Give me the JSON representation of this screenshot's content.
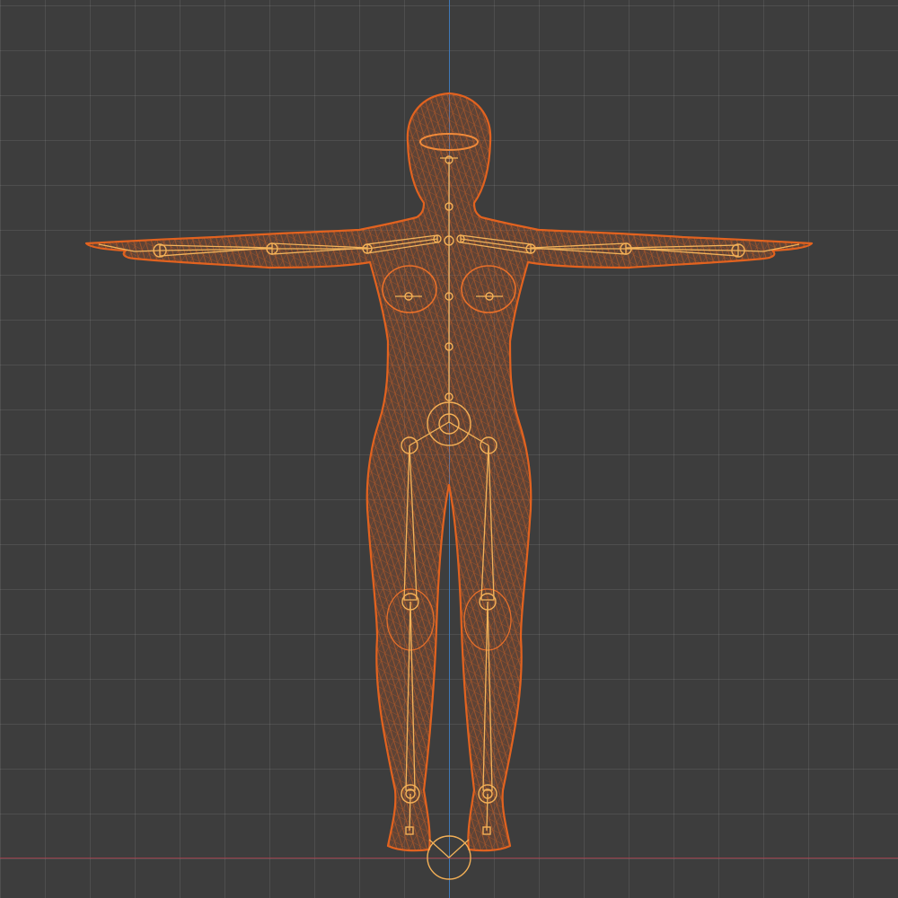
{
  "viewport": {
    "type": "3d-viewport",
    "view": "front-orthographic",
    "shading": "wireframe",
    "background_color": "#3d3d3d",
    "grid_color": "#4a4a4a",
    "axis_colors": {
      "vertical_axis": "#3f78b8",
      "horizontal_axis": "#9a3f4b"
    }
  },
  "scene": {
    "objects": [
      {
        "name": "human-body-mesh",
        "kind": "mesh",
        "selected": true,
        "color": "#e2621f"
      },
      {
        "name": "skeleton-armature",
        "kind": "armature",
        "pose": "T-pose",
        "selected": true,
        "color": "#f4b056"
      }
    ]
  }
}
